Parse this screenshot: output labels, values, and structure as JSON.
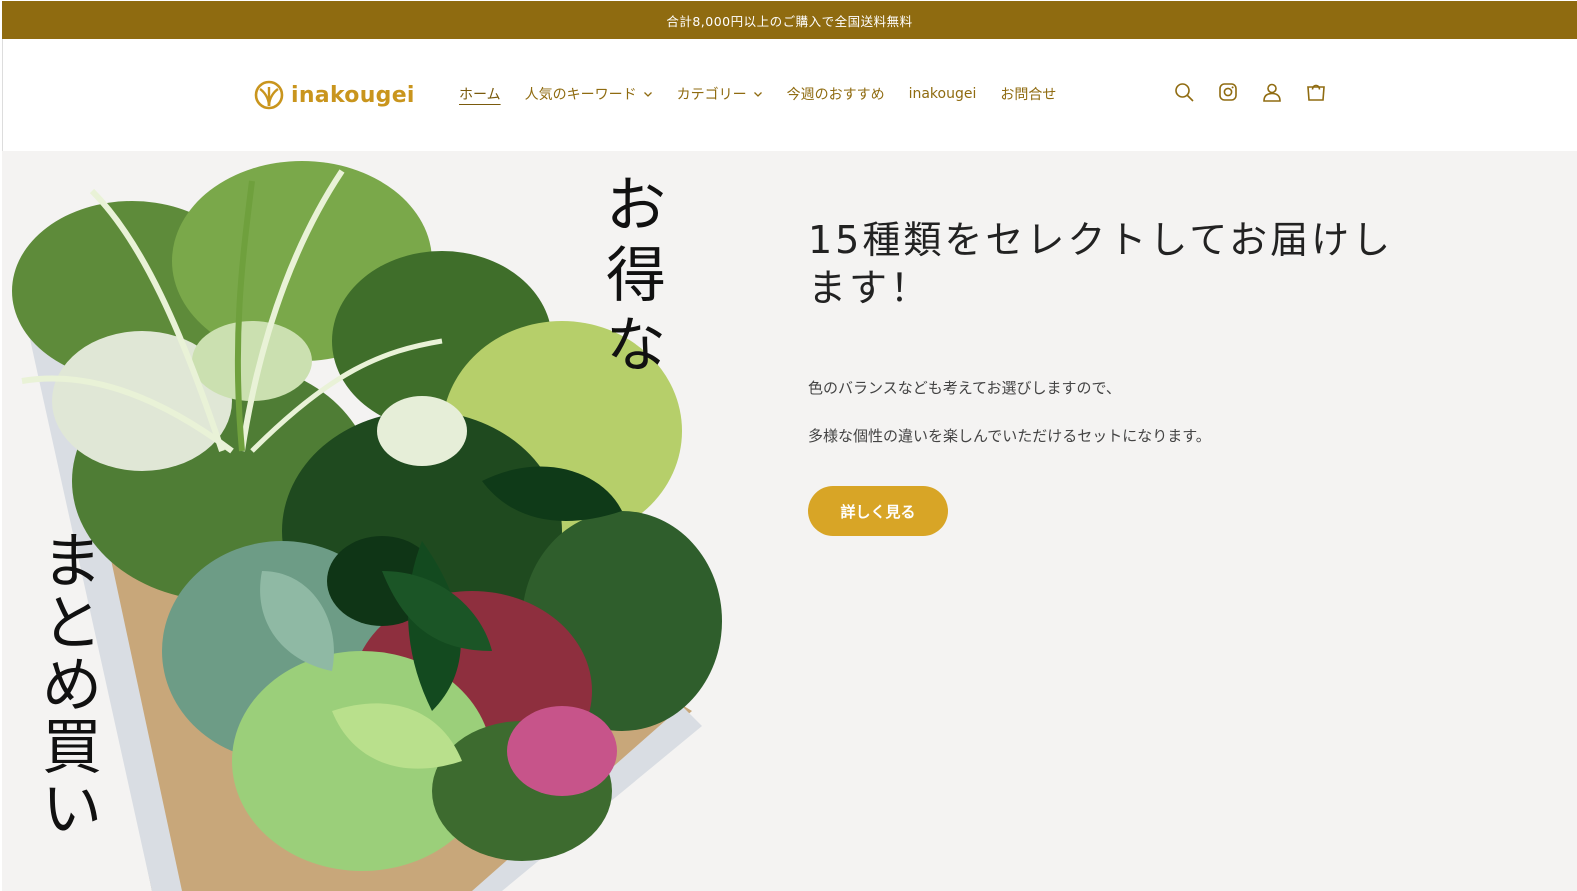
{
  "announcement": {
    "text": "合計8,000円以上のご購入で全国送料無料"
  },
  "header": {
    "logo_text": "inakougei",
    "nav": [
      {
        "label": "ホーム",
        "active": true,
        "dropdown": false
      },
      {
        "label": "人気のキーワード",
        "active": false,
        "dropdown": true
      },
      {
        "label": "カテゴリー",
        "active": false,
        "dropdown": true
      },
      {
        "label": "今週のおすすめ",
        "active": false,
        "dropdown": false
      },
      {
        "label": "inakougei",
        "active": false,
        "dropdown": false
      },
      {
        "label": "お問合せ",
        "active": false,
        "dropdown": false
      }
    ],
    "icons": [
      "search-icon",
      "instagram-icon",
      "account-icon",
      "cart-icon"
    ]
  },
  "hero": {
    "image_text_top": "お得な",
    "image_text_left": "まとめ買い",
    "title": "15種類をセレクトしてお届けします！",
    "desc_line1": "色のバランスなども考えてお選びしますので、",
    "desc_line2": "多様な個性の違いを楽しんでいただけるセットになります。",
    "button_label": "詳しく見る"
  },
  "colors": {
    "brand": "#8f6b10",
    "accent": "#d8a526",
    "logo": "#c9951d",
    "hero_bg": "#f4f3f2"
  }
}
